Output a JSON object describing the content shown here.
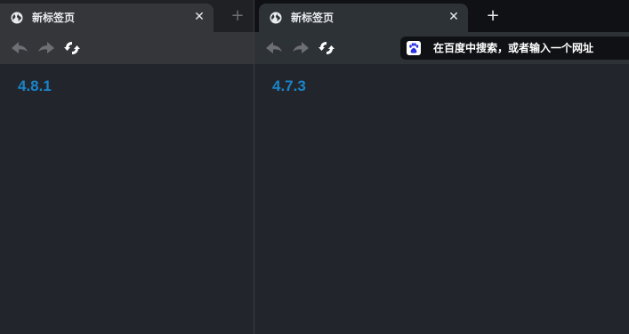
{
  "left_window": {
    "tab": {
      "title": "新标签页",
      "close_glyph": "✕"
    },
    "new_tab_glyph": "+",
    "toolbar": {
      "back_icon": "back-arrow-icon",
      "forward_icon": "forward-arrow-icon",
      "reload_icon": "reload-icon"
    },
    "content": {
      "version": "4.8.1"
    }
  },
  "right_window": {
    "tab": {
      "title": "新标签页",
      "close_glyph": "✕"
    },
    "new_tab_glyph": "+",
    "toolbar": {
      "back_icon": "back-arrow-icon",
      "forward_icon": "forward-arrow-icon",
      "reload_icon": "reload-icon"
    },
    "omnibox": {
      "search_engine_icon": "baidu-icon",
      "placeholder": "在百度中搜索，或者输入一个网址"
    },
    "content": {
      "version": "4.7.3"
    }
  },
  "colors": {
    "version_text": "#1a84c8",
    "content_bg": "#22252c",
    "text_light": "#e8eaed"
  }
}
